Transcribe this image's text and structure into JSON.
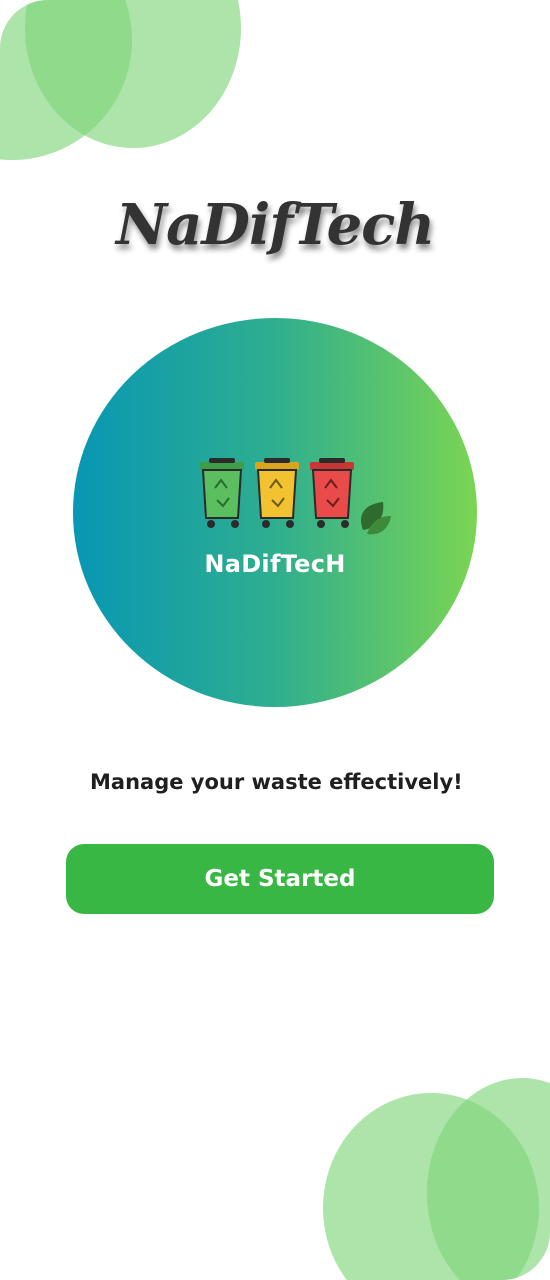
{
  "app": {
    "title": "NaDifTech"
  },
  "logo": {
    "text": "NaDifTecH",
    "bins": [
      "green-recycle-bin",
      "yellow-recycle-bin",
      "red-recycle-bin"
    ]
  },
  "tagline": "Manage your waste effectively!",
  "cta": {
    "label": "Get Started"
  },
  "colors": {
    "accent": "#38b744",
    "blob": "#7fd57b",
    "gradient_start": "#0797b3",
    "gradient_end": "#7bd553",
    "bin_green": "#5cbf5f",
    "bin_yellow": "#f2c230",
    "bin_red": "#e94b4b"
  }
}
